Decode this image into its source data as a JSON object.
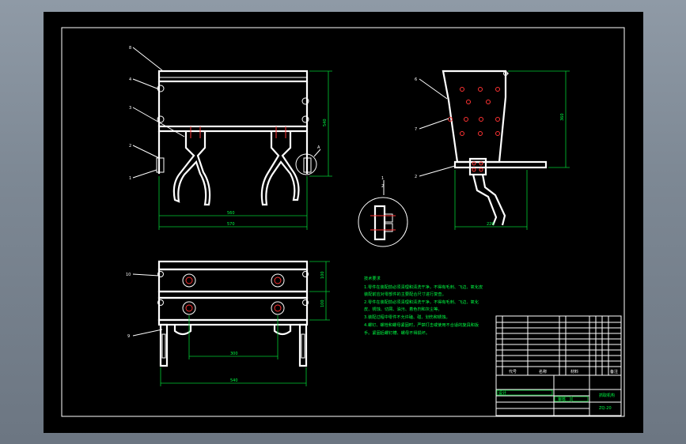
{
  "drawing": {
    "part_labels": {
      "front_top": "8",
      "front_4": "4",
      "front_3": "3",
      "front_2": "2",
      "front_1": "1",
      "detail_mark": "A",
      "side_6": "6",
      "side_7": "7",
      "side_2": "2",
      "section_1": "1",
      "section_2": "2",
      "bottom_10": "10",
      "bottom_9": "9"
    },
    "dimensions": {
      "front_width_inner": "560",
      "front_width_outer": "570",
      "front_height": "540",
      "side_height": "360",
      "side_width": "220",
      "bottom_height_top": "100",
      "bottom_height_mid": "100",
      "bottom_inner": "300",
      "bottom_outer": "540"
    },
    "notes": {
      "title": "技术要求",
      "lines": [
        "1.零件在装配前必须清理和清洗干净，不得有毛刺、飞边、氧化皮",
        "装配前应对零部件的主要配合尺寸进行复查。",
        "2.零件在装配前必须清理和清洗干净，不得有毛刺、飞边、氧化",
        "皮、锈蚀、切屑、油污、着色剂和灰尘等。",
        "3.装配过程中零件不允许磕、碰、划伤和锈蚀。",
        "4.螺钉、螺栓和螺母紧固时，严禁打击或使用不合适的旋具和扳",
        "手。紧固后螺钉槽、螺母不得损坏。"
      ]
    },
    "title_block": {
      "header_seq": "序号",
      "header_code": "代号",
      "header_name": "名称",
      "header_qty": "数量",
      "header_material": "材料",
      "header_note": "备注",
      "drawing_name": "抓取机构",
      "drawing_no": "ZQ-20",
      "designer": "设计",
      "checker": "审核"
    }
  }
}
